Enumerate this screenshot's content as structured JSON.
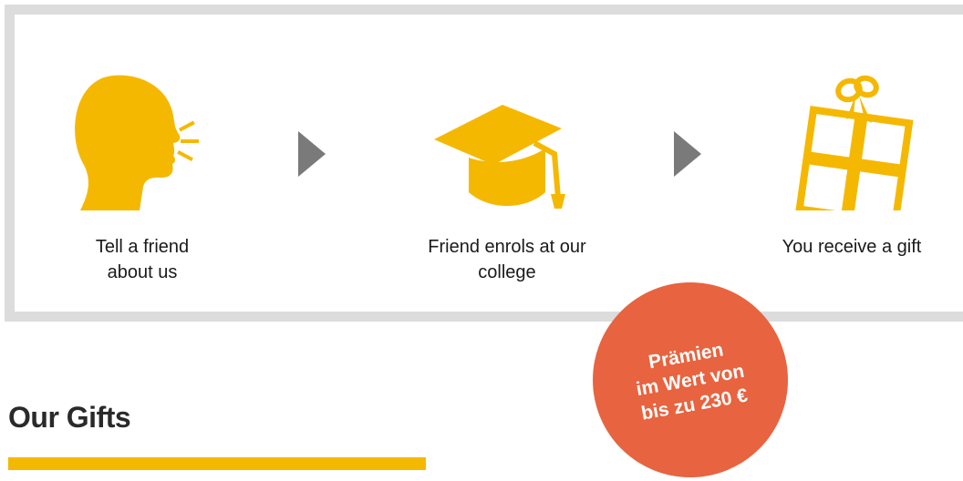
{
  "steps": [
    {
      "icon": "talking-head-icon",
      "label_line1": "Tell a friend",
      "label_line2": "about us"
    },
    {
      "icon": "graduation-cap-icon",
      "label_line1": "Friend enrols at our",
      "label_line2": "college"
    },
    {
      "icon": "gift-box-icon",
      "label_line1": "You receive a gift",
      "label_line2": ""
    }
  ],
  "badge": {
    "line1": "Prämien",
    "line2": "im Wert von",
    "line3": "bis zu 230 €"
  },
  "section": {
    "title": "Our Gifts"
  },
  "colors": {
    "accent": "#f5b800",
    "badge": "#e8633f",
    "arrow": "#7a7a7a",
    "panel_border": "#dcdcdc"
  }
}
